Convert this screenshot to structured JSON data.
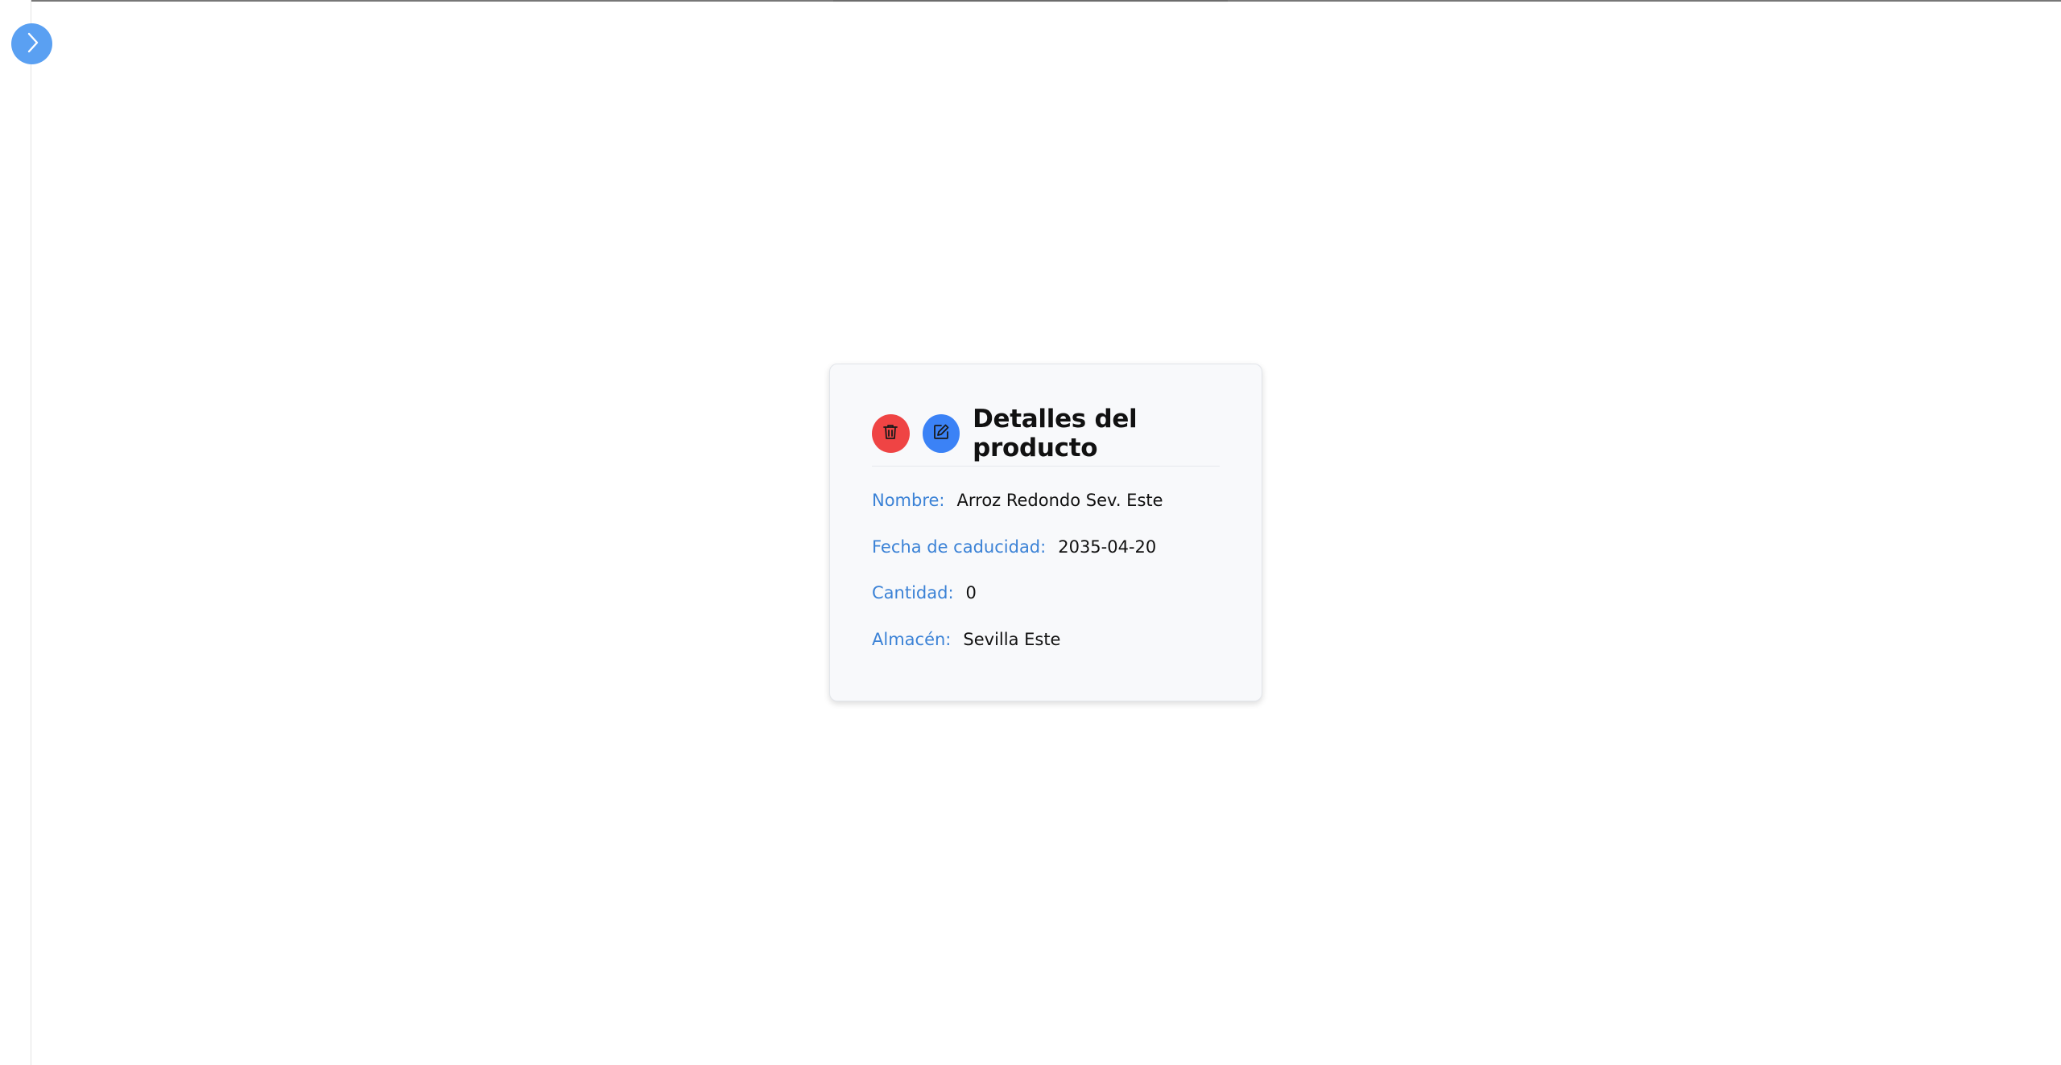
{
  "sidebar": {
    "toggle_icon": "chevron-right-icon",
    "accent": "#5aa0f2"
  },
  "card": {
    "title": "Detalles del producto",
    "actions": {
      "delete_icon": "trash-icon",
      "delete_color": "#ef4444",
      "edit_icon": "edit-icon",
      "edit_color": "#3b82f6"
    },
    "fields": [
      {
        "label": "Nombre:",
        "value": "Arroz Redondo Sev. Este"
      },
      {
        "label": "Fecha de caducidad:",
        "value": "2035-04-20"
      },
      {
        "label": "Cantidad:",
        "value": "0"
      },
      {
        "label": "Almacén:",
        "value": "Sevilla Este"
      }
    ]
  }
}
